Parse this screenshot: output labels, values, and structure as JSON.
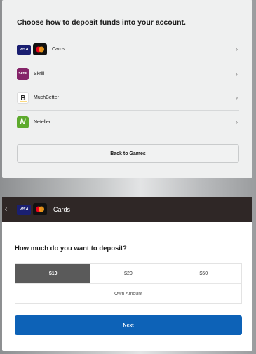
{
  "deposit_methods": {
    "title": "Choose how to deposit funds into your account.",
    "items": [
      {
        "label": "Cards",
        "logos": [
          "visa-logo",
          "mastercard-logo"
        ]
      },
      {
        "label": "Skrill",
        "logo_text": "Skrill"
      },
      {
        "label": "MuchBetter",
        "logo_text": "B"
      },
      {
        "label": "Neteller",
        "logo_text": "N"
      }
    ],
    "chevron": "›",
    "back_button": "Back to Games"
  },
  "cards_screen": {
    "back_arrow": "‹",
    "visa_text": "VISA",
    "header_title": "Cards",
    "question": "How much do you want to deposit?",
    "amounts": [
      "$10",
      "$20",
      "$50"
    ],
    "selected_amount": "$10",
    "own_amount": "Own Amount",
    "next_button": "Next"
  },
  "colors": {
    "header_bg": "#2f2726",
    "next_button": "#0d62b7",
    "selected_amount_bg": "#5a5a5a",
    "skrill": "#852469",
    "neteller": "#5daa2d",
    "visa": "#1a1f71"
  }
}
